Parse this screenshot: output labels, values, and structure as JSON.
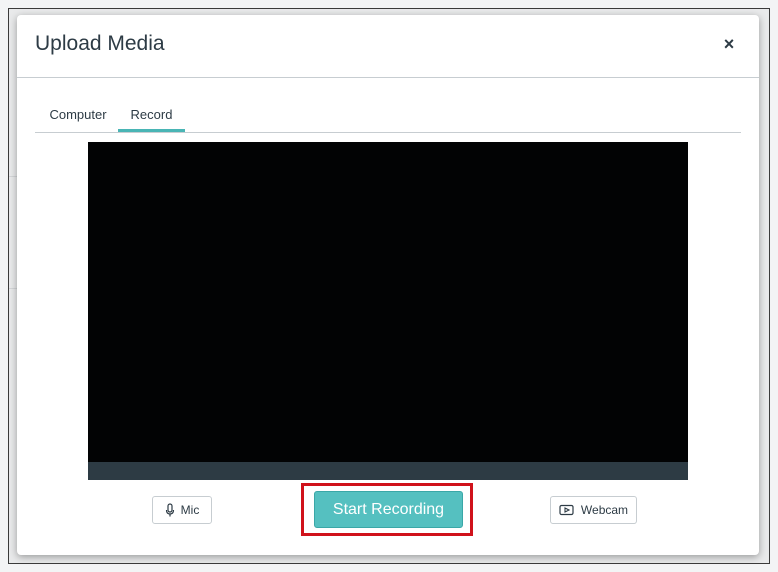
{
  "dialog": {
    "title": "Upload Media",
    "close_symbol": "×",
    "close_icon": "close-icon"
  },
  "tabs": [
    {
      "label": "Computer",
      "active": false
    },
    {
      "label": "Record",
      "active": true
    }
  ],
  "controls": {
    "mic_label": "Mic",
    "mic_icon": "microphone-icon",
    "start_label": "Start Recording",
    "webcam_label": "Webcam",
    "webcam_icon": "video-camera-icon"
  },
  "colors": {
    "accent": "#49b5b5",
    "start_button": "#55c0c0",
    "highlight_border": "#d0121b",
    "video_bg": "#020304",
    "video_bar": "#2d3b44"
  }
}
